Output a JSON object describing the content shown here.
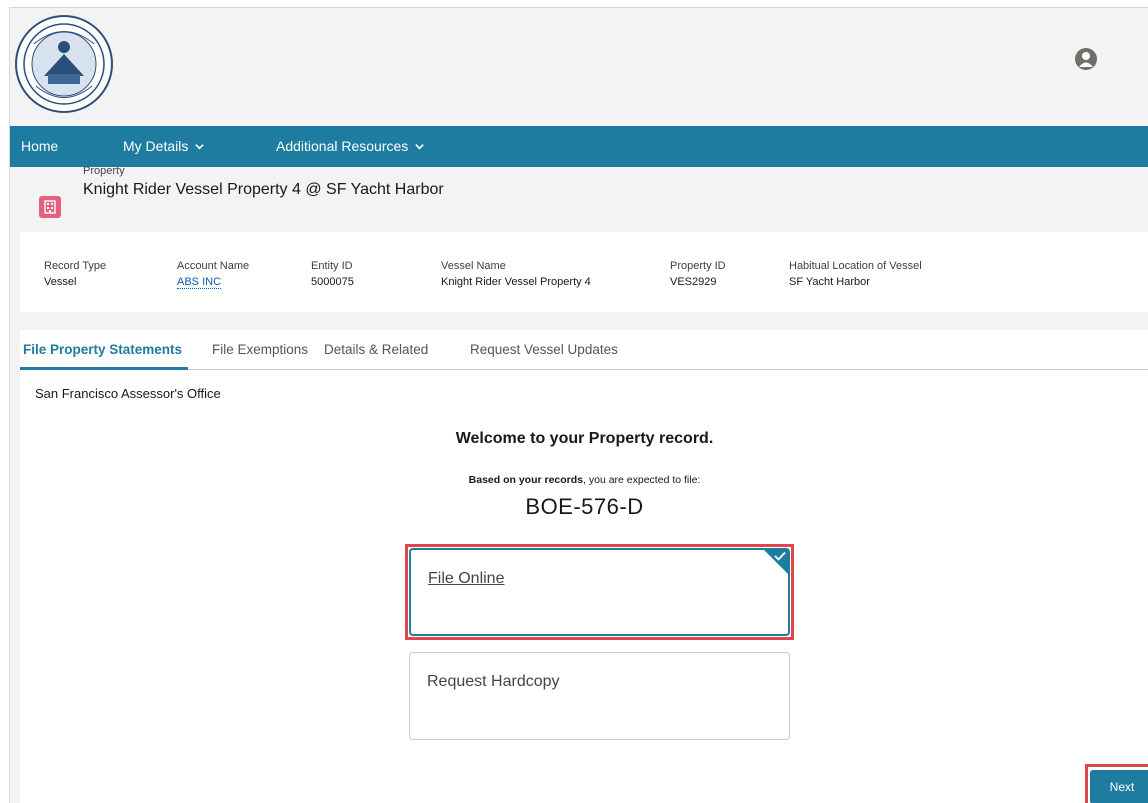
{
  "nav": {
    "home": "Home",
    "my_details": "My Details",
    "additional_resources": "Additional Resources"
  },
  "record": {
    "type_label": "Property",
    "title": "Knight Rider Vessel Property 4 @ SF Yacht Harbor"
  },
  "highlights": [
    {
      "label": "Record Type",
      "value": "Vessel"
    },
    {
      "label": "Account Name",
      "value": "ABS INC"
    },
    {
      "label": "Entity ID",
      "value": "5000075"
    },
    {
      "label": "Vessel Name",
      "value": "Knight Rider Vessel Property 4"
    },
    {
      "label": "Property ID",
      "value": "VES2929"
    },
    {
      "label": "Habitual Location of Vessel",
      "value": "SF Yacht Harbor"
    }
  ],
  "tabs": [
    {
      "label": "File Property Statements",
      "active": true
    },
    {
      "label": "File Exemptions",
      "active": false
    },
    {
      "label": "Details & Related",
      "active": false
    },
    {
      "label": "Request Vessel Updates",
      "active": false
    }
  ],
  "content": {
    "org_name": "San Francisco Assessor's Office",
    "welcome": "Welcome to your Property record.",
    "based_bold": "Based on your records",
    "based_rest": ", you are expected to file:",
    "form_name": "BOE-576-D",
    "options": [
      {
        "label": "File Online",
        "selected": true
      },
      {
        "label": "Request Hardcopy",
        "selected": false
      }
    ],
    "next_label": "Next"
  },
  "colors": {
    "nav_bg": "#1f7ca1",
    "accent": "#1f7ca1",
    "record_icon": "#e3617f",
    "highlight_border": "#e0474c",
    "link": "#0b5cab"
  },
  "icons": {
    "seal": "city-seal-icon",
    "user": "user-avatar-icon",
    "record": "building-icon",
    "chevron": "chevron-down-icon",
    "check": "checkmark-icon"
  }
}
